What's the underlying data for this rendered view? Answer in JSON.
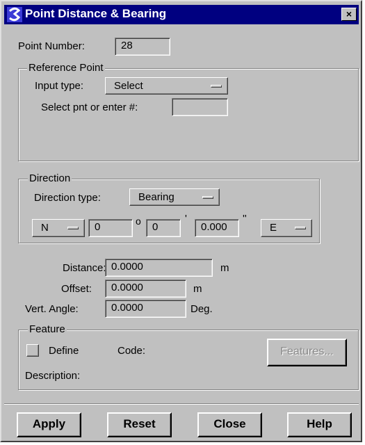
{
  "window": {
    "title": "Point Distance & Bearing",
    "close_label": "×"
  },
  "point_number": {
    "label": "Point Number:",
    "value": "28"
  },
  "reference_point": {
    "group_title": "Reference Point",
    "input_type_label": "Input type:",
    "input_type_value": "Select",
    "select_pnt_label": "Select pnt or enter #:",
    "select_pnt_value": ""
  },
  "direction": {
    "group_title": "Direction",
    "type_label": "Direction type:",
    "type_value": "Bearing",
    "ns_value": "N",
    "degrees_value": "0",
    "degree_symbol": "o",
    "minutes_value": "0",
    "minute_symbol": "'",
    "seconds_value": "0.000",
    "second_symbol": "''",
    "ew_value": "E"
  },
  "distance": {
    "label": "Distance:",
    "value": "0.0000",
    "unit": "m"
  },
  "offset": {
    "label": "Offset:",
    "value": "0.0000",
    "unit": "m"
  },
  "vert_angle": {
    "label": "Vert. Angle:",
    "value": "0.0000",
    "unit": "Deg."
  },
  "feature": {
    "group_title": "Feature",
    "define_label": "Define",
    "define_checked": false,
    "code_label": "Code:",
    "features_button": "Features...",
    "description_label": "Description:"
  },
  "buttons": {
    "apply": "Apply",
    "reset": "Reset",
    "close": "Close",
    "help": "Help"
  },
  "colors": {
    "titlebar": "#000080",
    "face": "#c0c0c0",
    "icon": "#3b3bd6"
  },
  "icons": {
    "app": "terramodel-s-icon",
    "close": "close-icon"
  }
}
